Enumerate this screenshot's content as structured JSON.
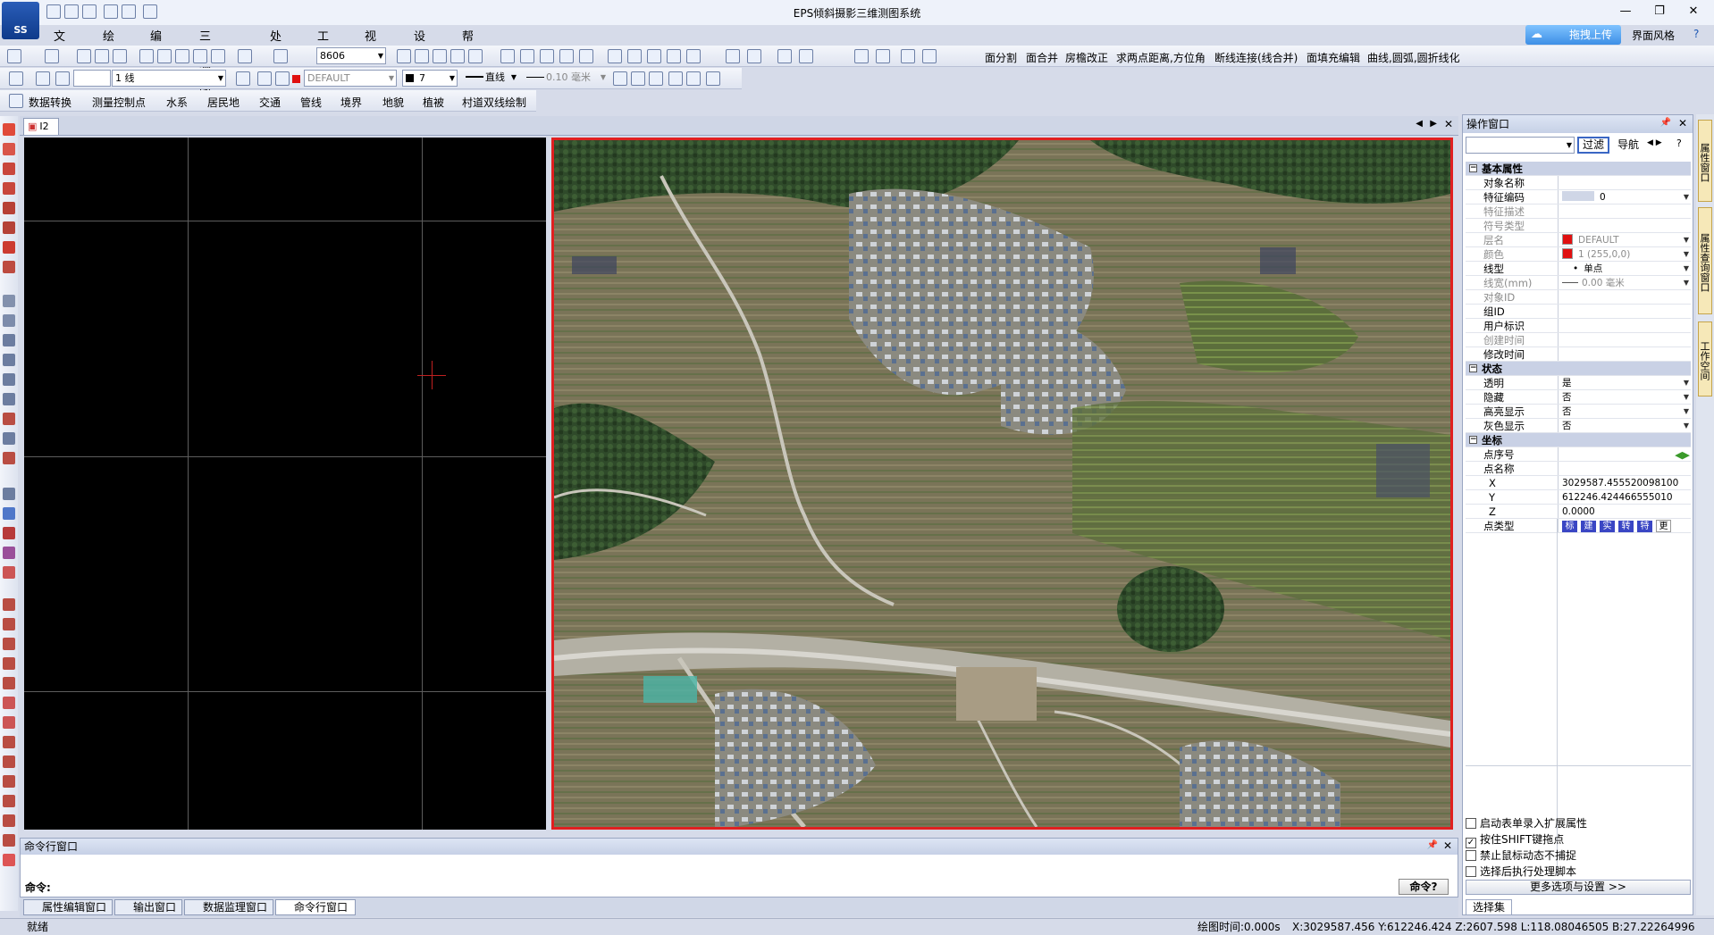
{
  "app": {
    "title": "EPS倾斜摄影三维测图系统",
    "logo_text": "SS",
    "upload_button": "拖拽上传",
    "style_label": "界面风格"
  },
  "menus": [
    "文件",
    "绘图",
    "编辑",
    "三维测图",
    "处理",
    "工具",
    "视图",
    "设置",
    "帮助"
  ],
  "toolbar1": {
    "code_value": "8606",
    "items": [
      "面分割",
      "面合并",
      "房檐改正",
      "求两点距离,方位角",
      "断线连接(线合并)",
      "面填充编辑",
      "曲线,圆弧,圆折线化"
    ]
  },
  "toolbar2": {
    "line_combo": "1 线",
    "layer_combo": "DEFAULT",
    "color_combo": "7",
    "linetype_combo": "直线",
    "width_combo": "0.10 毫米"
  },
  "toolbar3": {
    "items": [
      "数据转换",
      "测量控制点",
      "水系",
      "居民地",
      "交通",
      "管线",
      "境界",
      "地貌",
      "植被",
      "村道双线绘制"
    ]
  },
  "doc_tab": "I2",
  "command": {
    "title": "命令行窗口",
    "prompt": "命令:",
    "button": "命令?"
  },
  "bottom_tabs": [
    "属性编辑窗口",
    "输出窗口",
    "数据监理窗口",
    "命令行窗口"
  ],
  "status": {
    "left": "就绪",
    "draw_time": "绘图时间:0.000s",
    "coords": "X:3029587.456 Y:612246.424 Z:2607.598 L:118.08046505 B:27.22264996"
  },
  "operation": {
    "title": "操作窗口",
    "filter_button": "过滤",
    "nav_button": "导航",
    "sections": {
      "basic": "基本属性",
      "state": "状态",
      "coord": "坐标"
    },
    "basic_rows": [
      {
        "k": "对象名称",
        "v": ""
      },
      {
        "k": "特征编码",
        "v": "0"
      },
      {
        "k": "特征描述",
        "v": ""
      },
      {
        "k": "符号类型",
        "v": ""
      },
      {
        "k": "层名",
        "v": "DEFAULT"
      },
      {
        "k": "颜色",
        "v": "1 (255,0,0)"
      },
      {
        "k": "线型",
        "v": "单点"
      },
      {
        "k": "线宽(mm)",
        "v": "0.00 毫米"
      },
      {
        "k": "对象ID",
        "v": ""
      },
      {
        "k": "组ID",
        "v": ""
      },
      {
        "k": "用户标识",
        "v": ""
      },
      {
        "k": "创建时间",
        "v": ""
      },
      {
        "k": "修改时间",
        "v": ""
      }
    ],
    "state_rows": [
      {
        "k": "透明",
        "v": "是"
      },
      {
        "k": "隐藏",
        "v": "否"
      },
      {
        "k": "高亮显示",
        "v": "否"
      },
      {
        "k": "灰色显示",
        "v": "否"
      }
    ],
    "coord_rows": [
      {
        "k": "点序号",
        "v": ""
      },
      {
        "k": "点名称",
        "v": ""
      },
      {
        "k": "X",
        "v": "3029587.455520098100"
      },
      {
        "k": "Y",
        "v": "612246.424466555010"
      },
      {
        "k": "Z",
        "v": "0.0000"
      }
    ],
    "point_type_label": "点类型",
    "point_types": [
      "标",
      "建",
      "实",
      "转",
      "特",
      "更"
    ]
  },
  "options": [
    "启动表单录入扩展属性",
    "按住SHIFT键拖点",
    "禁止鼠标动态不捕捉",
    "选择后执行处理脚本"
  ],
  "more_button": "更多选项与设置 >>",
  "selection_tab": "选择集",
  "right_tabs": [
    "属性窗口",
    "属性查询窗口",
    "工作空间"
  ]
}
